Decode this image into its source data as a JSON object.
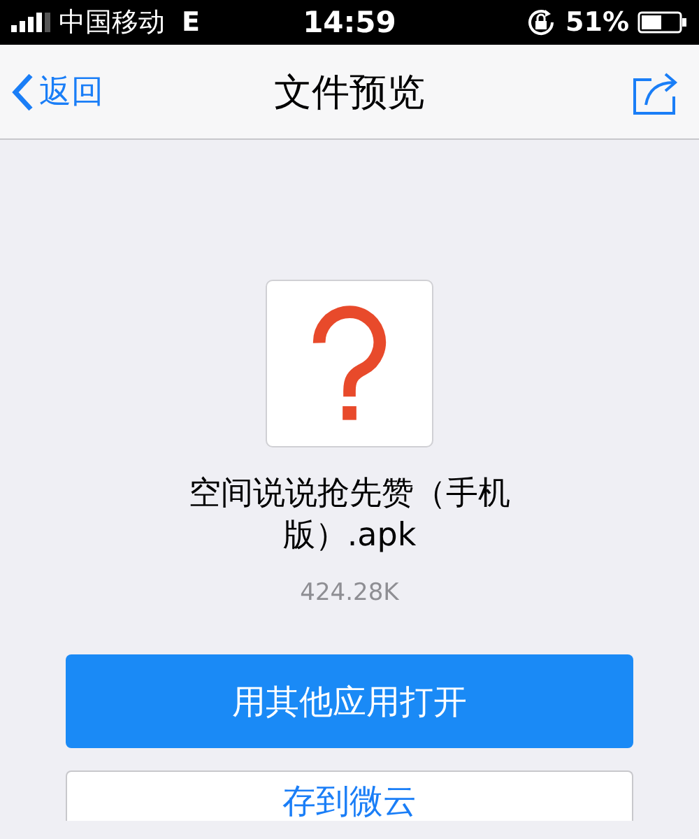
{
  "status_bar": {
    "carrier": "中国移动",
    "network": "E",
    "time": "14:59",
    "battery": "51%"
  },
  "nav_bar": {
    "back": "返回",
    "title": "文件预览"
  },
  "file": {
    "name": "空间说说抢先赞（手机版）.apk",
    "size": "424.28K"
  },
  "buttons": [
    {
      "label": "用其他应用打开",
      "kind": "primary"
    },
    {
      "label": "存到微云",
      "kind": "secondary"
    }
  ]
}
